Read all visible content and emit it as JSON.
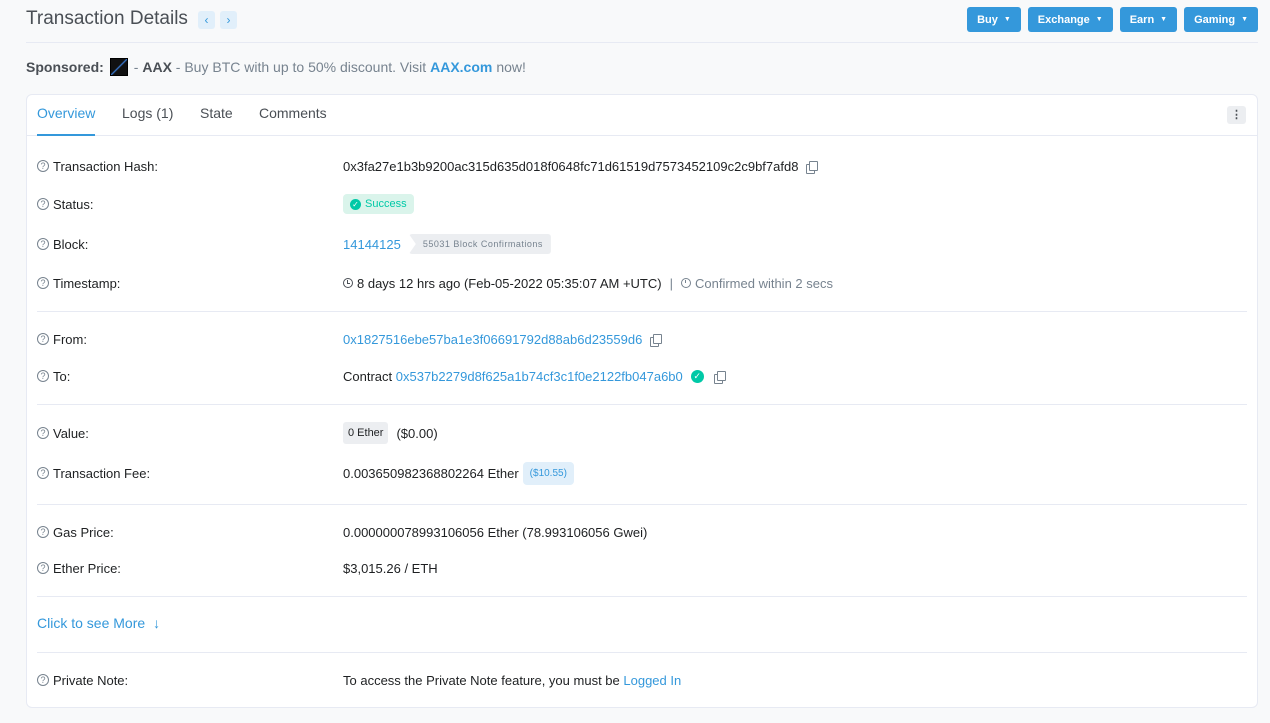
{
  "header": {
    "title": "Transaction Details",
    "prev_glyph": "‹",
    "next_glyph": "›",
    "buttons": [
      "Buy",
      "Exchange",
      "Earn",
      "Gaming"
    ]
  },
  "sponsored": {
    "label": "Sponsored:",
    "name": "AAX",
    "text_before": "- Buy BTC with up to 50% discount. Visit",
    "link": "AAX.com",
    "text_after": "now!"
  },
  "tabs": [
    "Overview",
    "Logs (1)",
    "State",
    "Comments"
  ],
  "fields": {
    "hash": {
      "label": "Transaction Hash:",
      "value": "0x3fa27e1b3b9200ac315d635d018f0648fc71d61519d7573452109c2c9bf7afd8"
    },
    "status": {
      "label": "Status:",
      "value": "Success"
    },
    "block": {
      "label": "Block:",
      "value": "14144125",
      "confirmations": "55031 Block Confirmations"
    },
    "timestamp": {
      "label": "Timestamp:",
      "value": "8 days 12 hrs ago (Feb-05-2022 05:35:07 AM +UTC)",
      "sep": "|",
      "confirmed": "Confirmed within 2 secs"
    },
    "from": {
      "label": "From:",
      "value": "0x1827516ebe57ba1e3f06691792d88ab6d23559d6"
    },
    "to": {
      "label": "To:",
      "prefix": "Contract",
      "value": "0x537b2279d8f625a1b74cf3c1f0e2122fb047a6b0"
    },
    "value": {
      "label": "Value:",
      "badge": "0 Ether",
      "usd": "($0.00)"
    },
    "fee": {
      "label": "Transaction Fee:",
      "value": "0.003650982368802264 Ether",
      "usd": "($10.55)"
    },
    "gas_price": {
      "label": "Gas Price:",
      "value": "0.000000078993106056 Ether (78.993106056 Gwei)"
    },
    "ether_price": {
      "label": "Ether Price:",
      "value": "$3,015.26 / ETH"
    },
    "more": {
      "label": "Click to see More"
    },
    "private_note": {
      "label": "Private Note:",
      "text": "To access the Private Note feature, you must be",
      "link": "Logged In"
    }
  },
  "colors": {
    "accent": "#3498db",
    "success": "#00c9a7",
    "muted": "#77838f"
  }
}
